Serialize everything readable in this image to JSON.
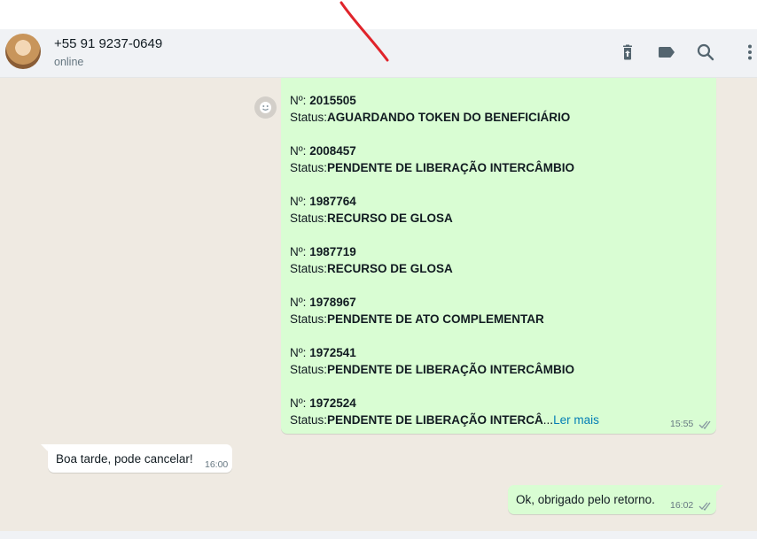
{
  "header": {
    "contact_name": "+55 91 9237-0649",
    "contact_status": "online",
    "icons": [
      "delete-icon",
      "label-icon",
      "search-icon",
      "menu-icon"
    ]
  },
  "messages": {
    "big": {
      "entries": [
        {
          "n_label": "Nº: ",
          "n_value": "2015505",
          "s_label": "Status:",
          "s_value": "AGUARDANDO TOKEN DO BENEFICIÁRIO"
        },
        {
          "n_label": "Nº: ",
          "n_value": "2008457",
          "s_label": "Status:",
          "s_value": "PENDENTE DE LIBERAÇÃO INTERCÂMBIO"
        },
        {
          "n_label": "Nº: ",
          "n_value": "1987764",
          "s_label": "Status:",
          "s_value": "RECURSO DE GLOSA"
        },
        {
          "n_label": "Nº: ",
          "n_value": "1987719",
          "s_label": "Status:",
          "s_value": "RECURSO DE GLOSA"
        },
        {
          "n_label": "Nº: ",
          "n_value": "1978967",
          "s_label": "Status:",
          "s_value": "PENDENTE DE ATO COMPLEMENTAR"
        },
        {
          "n_label": "Nº: ",
          "n_value": "1972541",
          "s_label": "Status:",
          "s_value": "PENDENTE DE LIBERAÇÃO INTERCÂMBIO"
        },
        {
          "n_label": "Nº: ",
          "n_value": "1972524",
          "s_label": "Status:",
          "s_value": "PENDENTE DE LIBERAÇÃO INTERCÂ"
        }
      ],
      "ellipsis": "...",
      "read_more": "Ler mais",
      "time": "15:55"
    },
    "incoming": {
      "text": "Boa tarde, pode cancelar!",
      "time": "16:00"
    },
    "outgoing": {
      "text": "Ok, obrigado pelo retorno.",
      "time": "16:02"
    }
  },
  "colors": {
    "header_bg": "#f0f2f5",
    "chat_bg": "#efeae2",
    "outgoing_bubble": "#d9fdd3",
    "incoming_bubble": "#ffffff",
    "link": "#027eb5",
    "annotation": "#e0242b"
  }
}
